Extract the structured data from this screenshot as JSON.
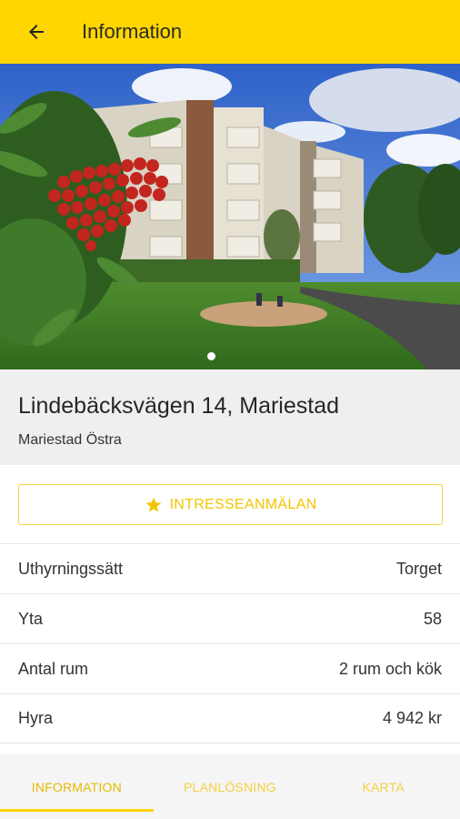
{
  "appbar": {
    "title": "Information",
    "back_icon": "arrow-left-icon"
  },
  "hero": {
    "image": "apartment-building-photo",
    "carousel_index": 1,
    "carousel_total": 1
  },
  "listing": {
    "address": "Lindebäcksvägen 14, Mariestad",
    "area": "Mariestad Östra"
  },
  "interest_button": {
    "label": "INTRESSEANMÄLAN",
    "icon": "star-icon"
  },
  "details": [
    {
      "label": "Uthyrningssätt",
      "value": "Torget"
    },
    {
      "label": "Yta",
      "value": "58"
    },
    {
      "label": "Antal rum",
      "value": "2 rum och kök"
    },
    {
      "label": "Hyra",
      "value": "4 942 kr"
    }
  ],
  "tabs": [
    {
      "label": "INFORMATION",
      "active": true
    },
    {
      "label": "PLANLÖSNING",
      "active": false
    },
    {
      "label": "KARTA",
      "active": false
    }
  ],
  "colors": {
    "accent": "#FFD600",
    "accent_text": "#F2C500"
  }
}
